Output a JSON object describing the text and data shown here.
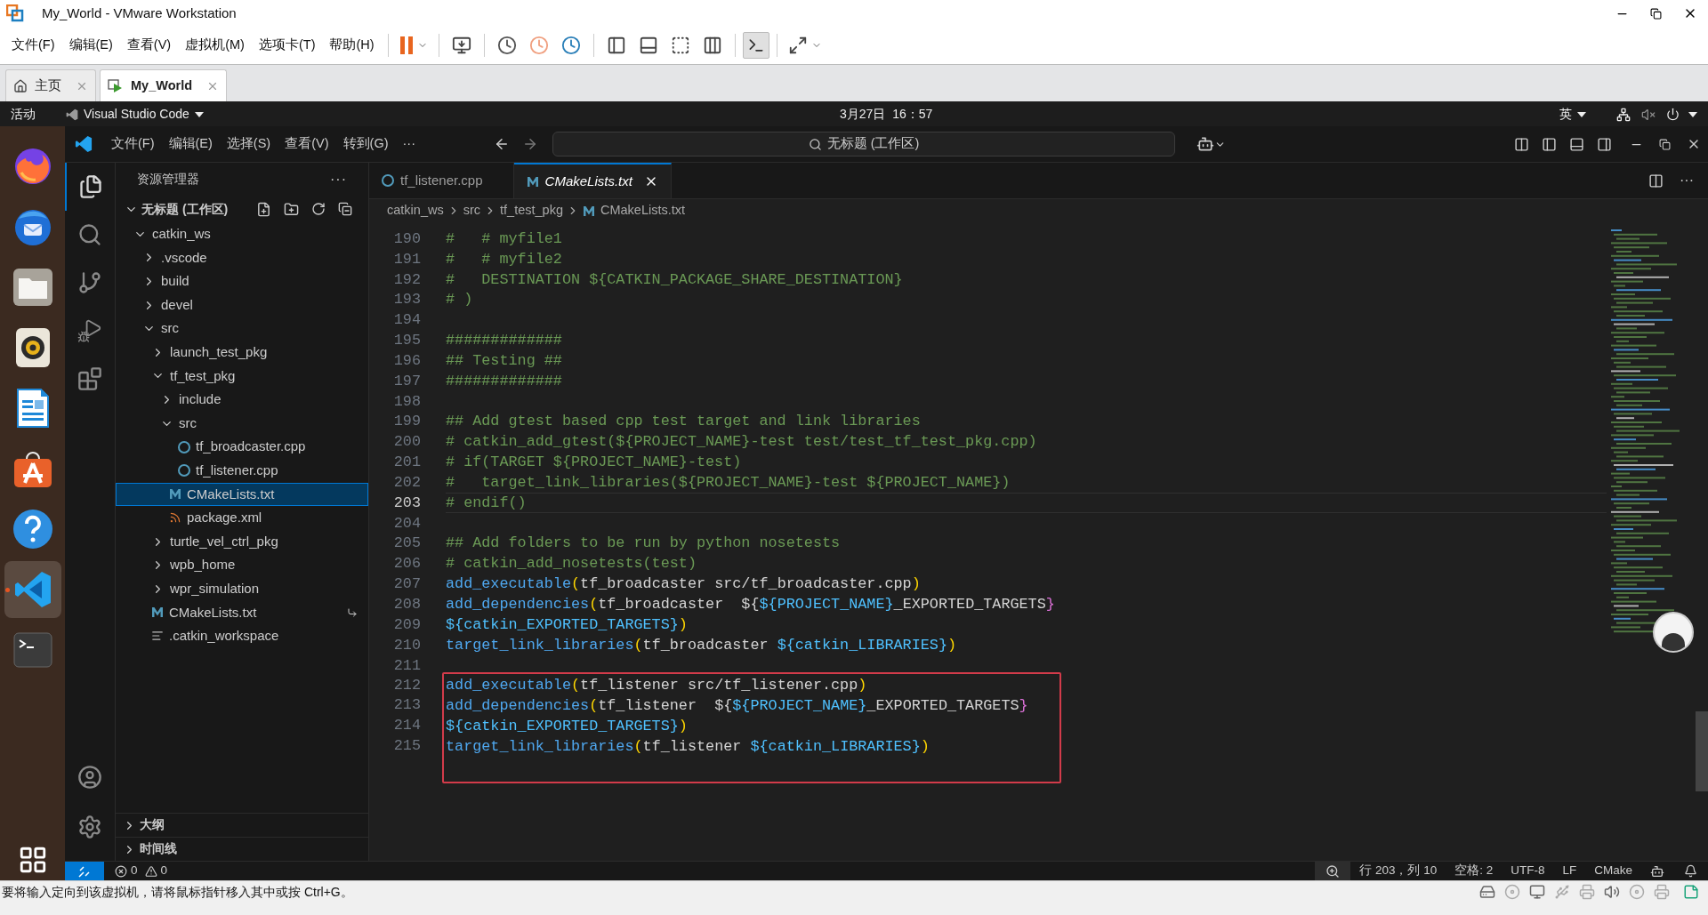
{
  "vmware": {
    "title": "My_World - VMware Workstation",
    "menu": [
      "文件(F)",
      "编辑(E)",
      "查看(V)",
      "虚拟机(M)",
      "选项卡(T)",
      "帮助(H)"
    ],
    "tabs": [
      {
        "label": "主页",
        "kind": "home",
        "selected": false
      },
      {
        "label": "My_World",
        "kind": "vm",
        "selected": true
      }
    ],
    "status_text": "要将输入定向到该虚拟机，请将鼠标指针移入其中或按 Ctrl+G。"
  },
  "ubuntu_bar": {
    "activities": "活动",
    "app": "Visual Studio Code",
    "clock": "3月27日  16：57",
    "input_method": "英"
  },
  "dock": [
    {
      "kind": "firefox",
      "selected": false
    },
    {
      "kind": "mail",
      "selected": false
    },
    {
      "kind": "files",
      "selected": false
    },
    {
      "kind": "speaker",
      "selected": false
    },
    {
      "kind": "writer",
      "selected": false
    },
    {
      "kind": "store",
      "selected": false
    },
    {
      "kind": "help",
      "selected": false
    },
    {
      "kind": "vscode",
      "selected": true
    },
    {
      "kind": "terminal",
      "selected": false
    }
  ],
  "vscode": {
    "menu": [
      "文件(F)",
      "编辑(E)",
      "选择(S)",
      "查看(V)",
      "转到(G)",
      "···"
    ],
    "command_center": "无标题 (工作区)",
    "sidebar": {
      "title": "资源管理器",
      "more": "···",
      "workspace": "无标题 (工作区)",
      "tree": [
        {
          "label": "catkin_ws",
          "kind": "folder",
          "expanded": true,
          "selected": false,
          "children": [
            {
              "label": ".vscode",
              "kind": "folder",
              "expanded": false,
              "selected": false
            },
            {
              "label": "build",
              "kind": "folder",
              "expanded": false,
              "selected": false
            },
            {
              "label": "devel",
              "kind": "folder",
              "expanded": false,
              "selected": false
            },
            {
              "label": "src",
              "kind": "folder",
              "expanded": true,
              "selected": false,
              "children": [
                {
                  "label": "launch_test_pkg",
                  "kind": "folder",
                  "expanded": false,
                  "selected": false
                },
                {
                  "label": "tf_test_pkg",
                  "kind": "folder",
                  "expanded": true,
                  "selected": false,
                  "children": [
                    {
                      "label": "include",
                      "kind": "folder",
                      "expanded": false,
                      "selected": false
                    },
                    {
                      "label": "src",
                      "kind": "folder",
                      "expanded": true,
                      "selected": false,
                      "children": [
                        {
                          "label": "tf_broadcaster.cpp",
                          "kind": "cpp",
                          "selected": false
                        },
                        {
                          "label": "tf_listener.cpp",
                          "kind": "cpp",
                          "selected": false
                        }
                      ]
                    },
                    {
                      "label": "CMakeLists.txt",
                      "kind": "cmake",
                      "selected": true
                    },
                    {
                      "label": "package.xml",
                      "kind": "xml",
                      "selected": false
                    }
                  ]
                },
                {
                  "label": "turtle_vel_ctrl_pkg",
                  "kind": "folder",
                  "expanded": false,
                  "selected": false
                },
                {
                  "label": "wpb_home",
                  "kind": "folder",
                  "expanded": false,
                  "selected": false
                },
                {
                  "label": "wpr_simulation",
                  "kind": "folder",
                  "expanded": false,
                  "selected": false
                }
              ]
            },
            {
              "label": "CMakeLists.txt",
              "kind": "cmake",
              "selected": false,
              "link": true
            },
            {
              "label": ".catkin_workspace",
              "kind": "text",
              "selected": false
            }
          ]
        }
      ],
      "panels": [
        "大纲",
        "时间线"
      ]
    },
    "editor_tabs": [
      {
        "label": "tf_listener.cpp",
        "kind": "cpp",
        "selected": false
      },
      {
        "label": "CMakeLists.txt",
        "kind": "cmake",
        "selected": true
      }
    ],
    "breadcrumbs": [
      {
        "label": "catkin_ws",
        "kind": "folder"
      },
      {
        "label": "src",
        "kind": "folder"
      },
      {
        "label": "tf_test_pkg",
        "kind": "folder"
      },
      {
        "label": "CMakeLists.txt",
        "kind": "cmake"
      }
    ],
    "lines": [
      {
        "number": "190",
        "current": false,
        "boxed": false,
        "tokens": [
          {
            "kind": "comment",
            "text": "#   # myfile1"
          }
        ]
      },
      {
        "number": "191",
        "current": false,
        "boxed": false,
        "tokens": [
          {
            "kind": "comment",
            "text": "#   # myfile2"
          }
        ]
      },
      {
        "number": "192",
        "current": false,
        "boxed": false,
        "tokens": [
          {
            "kind": "comment",
            "text": "#   DESTINATION ${CATKIN_PACKAGE_SHARE_DESTINATION}"
          }
        ]
      },
      {
        "number": "193",
        "current": false,
        "boxed": false,
        "tokens": [
          {
            "kind": "comment",
            "text": "# )"
          }
        ]
      },
      {
        "number": "194",
        "current": false,
        "boxed": false
      },
      {
        "number": "195",
        "current": false,
        "boxed": false,
        "tokens": [
          {
            "kind": "comment",
            "text": "#############"
          }
        ]
      },
      {
        "number": "196",
        "current": false,
        "boxed": false,
        "tokens": [
          {
            "kind": "comment",
            "text": "## Testing ##"
          }
        ]
      },
      {
        "number": "197",
        "current": false,
        "boxed": false,
        "tokens": [
          {
            "kind": "comment",
            "text": "#############"
          }
        ]
      },
      {
        "number": "198",
        "current": false,
        "boxed": false
      },
      {
        "number": "199",
        "current": false,
        "boxed": false,
        "tokens": [
          {
            "kind": "comment",
            "text": "## Add gtest based cpp test target and link libraries"
          }
        ]
      },
      {
        "number": "200",
        "current": false,
        "boxed": false,
        "tokens": [
          {
            "kind": "comment",
            "text": "# catkin_add_gtest(${PROJECT_NAME}-test test/test_tf_test_pkg.cpp)"
          }
        ]
      },
      {
        "number": "201",
        "current": false,
        "boxed": false,
        "tokens": [
          {
            "kind": "comment",
            "text": "# if(TARGET ${PROJECT_NAME}-test)"
          }
        ]
      },
      {
        "number": "202",
        "current": false,
        "boxed": false,
        "tokens": [
          {
            "kind": "comment",
            "text": "#   target_link_libraries(${PROJECT_NAME}-test ${PROJECT_NAME})"
          }
        ]
      },
      {
        "number": "203",
        "current": true,
        "boxed": false,
        "tokens": [
          {
            "kind": "comment",
            "text": "# endif()"
          }
        ]
      },
      {
        "number": "204",
        "current": false,
        "boxed": false
      },
      {
        "number": "205",
        "current": false,
        "boxed": false,
        "tokens": [
          {
            "kind": "comment",
            "text": "## Add folders to be run by python nosetests"
          }
        ]
      },
      {
        "number": "206",
        "current": false,
        "boxed": false,
        "tokens": [
          {
            "kind": "comment",
            "text": "# catkin_add_nosetests(test)"
          }
        ]
      },
      {
        "number": "207",
        "current": false,
        "boxed": false,
        "tokens": [
          {
            "kind": "function",
            "text": "add_executable"
          },
          {
            "kind": "paren",
            "text": "("
          },
          {
            "kind": "plain",
            "text": "tf_broadcaster src/tf_broadcaster.cpp"
          },
          {
            "kind": "paren",
            "text": ")"
          }
        ]
      },
      {
        "number": "208",
        "current": false,
        "boxed": false,
        "tokens": [
          {
            "kind": "function",
            "text": "add_dependencies"
          },
          {
            "kind": "paren",
            "text": "("
          },
          {
            "kind": "plain",
            "text": "tf_broadcaster  ${"
          },
          {
            "kind": "variable",
            "text": "${PROJECT_NAME}"
          },
          {
            "kind": "plain",
            "text": "_EXPORTED_TARGETS"
          },
          {
            "kind": "brace",
            "text": "}"
          }
        ]
      },
      {
        "number": "209",
        "current": false,
        "boxed": false,
        "tokens": [
          {
            "kind": "variable",
            "text": "${catkin_EXPORTED_TARGETS}"
          },
          {
            "kind": "paren",
            "text": ")"
          }
        ]
      },
      {
        "number": "210",
        "current": false,
        "boxed": false,
        "tokens": [
          {
            "kind": "function",
            "text": "target_link_libraries"
          },
          {
            "kind": "paren",
            "text": "("
          },
          {
            "kind": "plain",
            "text": "tf_broadcaster "
          },
          {
            "kind": "variable",
            "text": "${catkin_LIBRARIES}"
          },
          {
            "kind": "paren",
            "text": ")"
          }
        ]
      },
      {
        "number": "211",
        "current": false,
        "boxed": false
      },
      {
        "number": "212",
        "current": false,
        "boxed": true,
        "tokens": [
          {
            "kind": "function",
            "text": "add_executable"
          },
          {
            "kind": "paren",
            "text": "("
          },
          {
            "kind": "plain",
            "text": "tf_listener src/tf_listener.cpp"
          },
          {
            "kind": "paren",
            "text": ")"
          }
        ]
      },
      {
        "number": "213",
        "current": false,
        "boxed": true,
        "tokens": [
          {
            "kind": "function",
            "text": "add_dependencies"
          },
          {
            "kind": "paren",
            "text": "("
          },
          {
            "kind": "plain",
            "text": "tf_listener  ${"
          },
          {
            "kind": "variable",
            "text": "${PROJECT_NAME}"
          },
          {
            "kind": "plain",
            "text": "_EXPORTED_TARGETS"
          },
          {
            "kind": "brace",
            "text": "}"
          }
        ]
      },
      {
        "number": "214",
        "current": false,
        "boxed": true,
        "tokens": [
          {
            "kind": "variable",
            "text": "${catkin_EXPORTED_TARGETS}"
          },
          {
            "kind": "paren",
            "text": ")"
          }
        ]
      },
      {
        "number": "215",
        "current": false,
        "boxed": true,
        "tokens": [
          {
            "kind": "function",
            "text": "target_link_libraries"
          },
          {
            "kind": "paren",
            "text": "("
          },
          {
            "kind": "plain",
            "text": "tf_listener "
          },
          {
            "kind": "variable",
            "text": "${catkin_LIBRARIES}"
          },
          {
            "kind": "paren",
            "text": ")"
          }
        ]
      }
    ],
    "status": {
      "errors": "0",
      "warnings": "0",
      "items": [
        "行 203，列 10",
        "空格: 2",
        "UTF-8",
        "LF",
        "CMake"
      ]
    }
  }
}
